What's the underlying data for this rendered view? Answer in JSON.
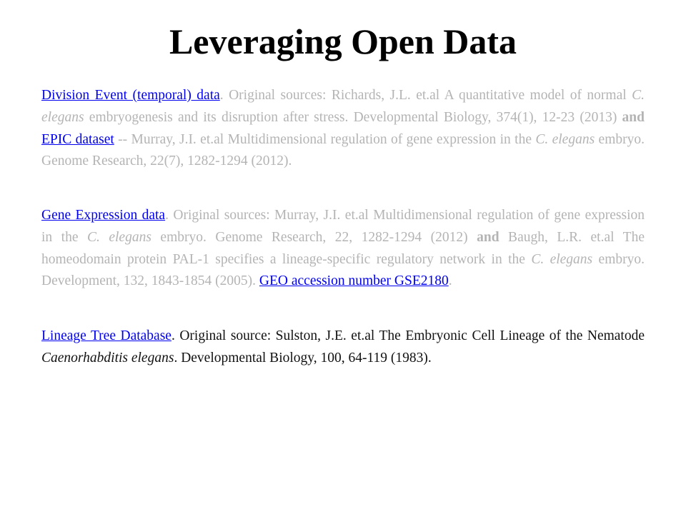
{
  "title": "Leveraging Open Data",
  "paragraphs": {
    "p1": {
      "link1": "Division Event (temporal) data",
      "t1": ". Original sources: Richards, J.L. et.al    A quantitative model of normal ",
      "i1": "C. elegans",
      "t2": " embryogenesis and its disruption after stress. Developmental Biology, 374(1), 12-23 (2013) ",
      "b1": "and",
      "t3": " ",
      "link2": "EPIC dataset",
      "t4": " -- Murray, J.I. et.al Multidimensional regulation of gene expression in the ",
      "i2": "C. elegans",
      "t5": " embryo. Genome Research, 22(7), 1282-1294 (2012)."
    },
    "p2": {
      "link1": "Gene Expression data",
      "t1": ". Original sources: Murray, J.I. et.al Multidimensional regulation of gene expression in the ",
      "i1": "C. elegans",
      "t2": " embryo. Genome Research, 22, 1282-1294 (2012) ",
      "b1": "and",
      "t3": " Baugh, L.R. et.al The homeodomain protein PAL-1 specifies a lineage-specific regulatory network in the ",
      "i2": "C. elegans",
      "t4": " embryo. Development, 132, 1843-1854 (2005). ",
      "link2": "GEO accession number GSE2180",
      "t5": "."
    },
    "p3": {
      "link1": "Lineage Tree Database",
      "t1": ". Original source: Sulston, J.E. et.al The Embryonic Cell Lineage of the Nematode ",
      "i1": "Caenorhabditis elegans",
      "t2": ". Developmental Biology, 100, 64-119 (1983)."
    }
  },
  "colors": {
    "link": "#0000ee",
    "faded_text": "#b4b4b4",
    "dark_text": "#111111",
    "title": "#000000"
  }
}
